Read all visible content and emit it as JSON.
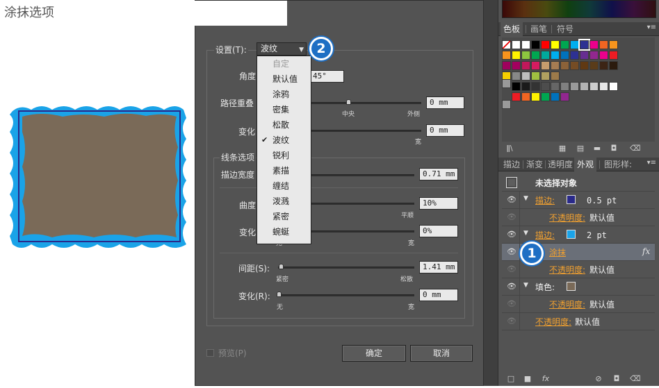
{
  "dialog": {
    "title": "涂抹选项",
    "setting_label": "设置(T):",
    "setting_value": "波纹",
    "angle_label": "角度",
    "angle_value": "45°",
    "path_overlap_label": "路径重叠",
    "path_overlap_value": "0 mm",
    "path_overlap_mid": "中央",
    "path_overlap_right": "外侧",
    "variation1_label": "变化",
    "variation1_value": "0 mm",
    "variation1_right": "宽",
    "line_options_label": "线条选项",
    "stroke_width_label": "描边宽度",
    "stroke_width_value": "0.71 mm",
    "curviness_label": "曲度",
    "curviness_value": "10%",
    "curviness_right": "平顺",
    "variation2_label": "变化",
    "variation2_value": "0%",
    "variation2_left": "无",
    "variation2_right": "宽",
    "spacing_label": "间距(S):",
    "spacing_value": "1.41 mm",
    "spacing_left": "紧密",
    "spacing_right": "松散",
    "variation3_label": "变化(R):",
    "variation3_value": "0 mm",
    "variation3_left": "无",
    "variation3_right": "宽",
    "preview_label": "预览(P)",
    "ok_label": "确定",
    "cancel_label": "取消"
  },
  "dropdown": {
    "items": [
      {
        "label": "自定",
        "disabled": true
      },
      {
        "label": "默认值"
      },
      {
        "label": "涂鸦"
      },
      {
        "label": "密集"
      },
      {
        "label": "松散"
      },
      {
        "label": "波纹",
        "checked": true
      },
      {
        "label": "锐利"
      },
      {
        "label": "素描"
      },
      {
        "label": "缠结"
      },
      {
        "label": "泼溅"
      },
      {
        "label": "紧密"
      },
      {
        "label": "蜿蜒"
      }
    ]
  },
  "badges": {
    "one": "1",
    "two": "2"
  },
  "swatch_panel": {
    "tabs": [
      "色板",
      "画笔",
      "符号"
    ]
  },
  "appearance_panel": {
    "tabs": [
      "描边",
      "渐变",
      "透明度",
      "外观",
      "图形样:"
    ],
    "header": "未选择对象",
    "rows": {
      "stroke1_label": "描边:",
      "stroke1_value": "0.5 pt",
      "opacity1_label": "不透明度:",
      "opacity1_value": "默认值",
      "stroke2_label": "描边:",
      "stroke2_value": "2 pt",
      "scribble_label": "涂抹",
      "fx_label": "fx",
      "opacity2_label": "不透明度:",
      "opacity2_value": "默认值",
      "fill_label": "填色:",
      "opacity3_label": "不透明度:",
      "opacity3_value": "默认值",
      "opacity4_label": "不透明度:",
      "opacity4_value": "默认值"
    }
  },
  "colors": {
    "artwork_fill": "#7a6a58",
    "artwork_stroke_outer": "#1aa3e8",
    "artwork_stroke_inner": "#2a2a8a",
    "badge": "#1e6fc4",
    "link": "#f0a030",
    "panel_bg": "#535353"
  }
}
